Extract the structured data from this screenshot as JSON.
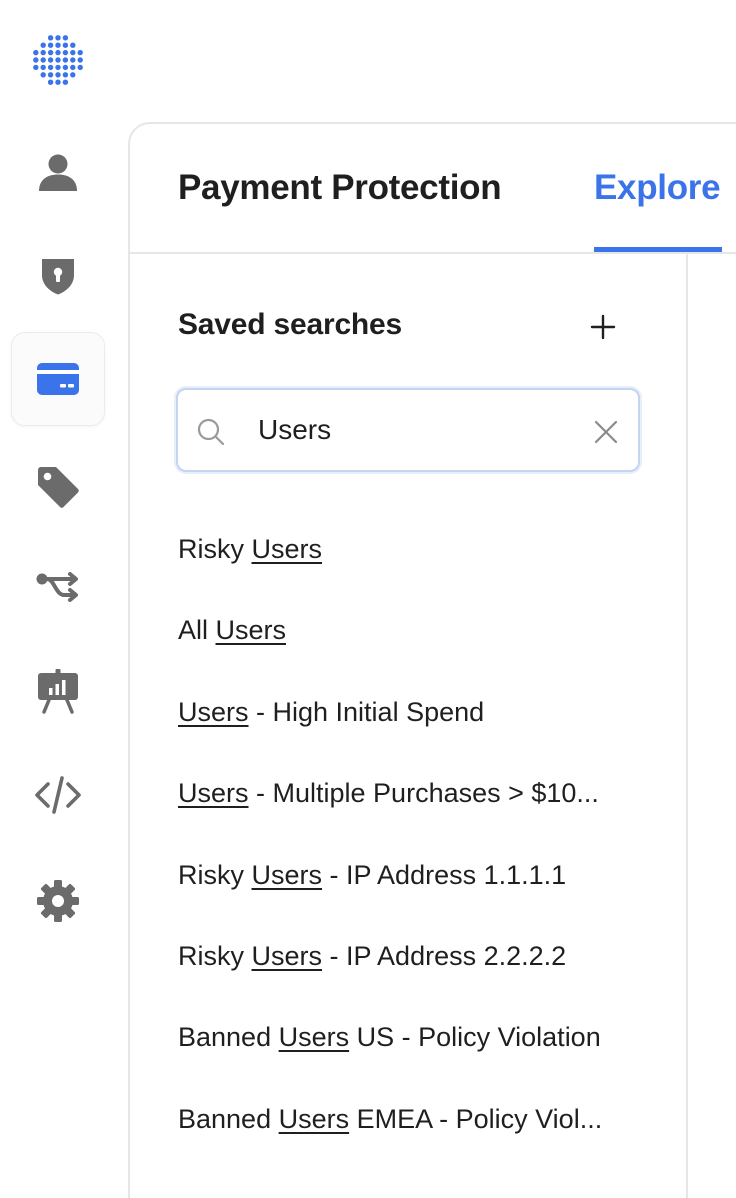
{
  "nav": {
    "items": [
      {
        "name": "user-icon",
        "active": false
      },
      {
        "name": "shield-lock-icon",
        "active": false
      },
      {
        "name": "credit-card-icon",
        "active": true
      },
      {
        "name": "tag-icon",
        "active": false
      },
      {
        "name": "workflow-icon",
        "active": false
      },
      {
        "name": "presentation-chart-icon",
        "active": false
      },
      {
        "name": "code-icon",
        "active": false
      },
      {
        "name": "gear-icon",
        "active": false
      }
    ]
  },
  "tabs": {
    "payment_protection": "Payment Protection",
    "explore": "Explore"
  },
  "saved_searches": {
    "title": "Saved searches",
    "search": {
      "value": "Users"
    },
    "results": [
      {
        "parts": [
          {
            "text": "Risky ",
            "hl": false
          },
          {
            "text": "Users",
            "hl": true
          }
        ]
      },
      {
        "parts": [
          {
            "text": "All ",
            "hl": false
          },
          {
            "text": "Users",
            "hl": true
          }
        ]
      },
      {
        "parts": [
          {
            "text": "Users",
            "hl": true
          },
          {
            "text": " - High Initial Spend",
            "hl": false
          }
        ]
      },
      {
        "parts": [
          {
            "text": "Users",
            "hl": true
          },
          {
            "text": " - Multiple Purchases > $10...",
            "hl": false
          }
        ]
      },
      {
        "parts": [
          {
            "text": "Risky ",
            "hl": false
          },
          {
            "text": "Users",
            "hl": true
          },
          {
            "text": " - IP Address 1.1.1.1",
            "hl": false
          }
        ]
      },
      {
        "parts": [
          {
            "text": "Risky ",
            "hl": false
          },
          {
            "text": "Users",
            "hl": true
          },
          {
            "text": " - IP Address 2.2.2.2",
            "hl": false
          }
        ]
      },
      {
        "parts": [
          {
            "text": "Banned ",
            "hl": false
          },
          {
            "text": "Users",
            "hl": true
          },
          {
            "text": " US - Policy Violation",
            "hl": false
          }
        ]
      },
      {
        "parts": [
          {
            "text": "Banned ",
            "hl": false
          },
          {
            "text": "Users",
            "hl": true
          },
          {
            "text": " EMEA - Policy Viol...",
            "hl": false
          }
        ]
      }
    ]
  },
  "colors": {
    "accent": "#3b73ea",
    "icon_gray": "#6b6b6b",
    "logo_blue": "#3b73ea"
  }
}
